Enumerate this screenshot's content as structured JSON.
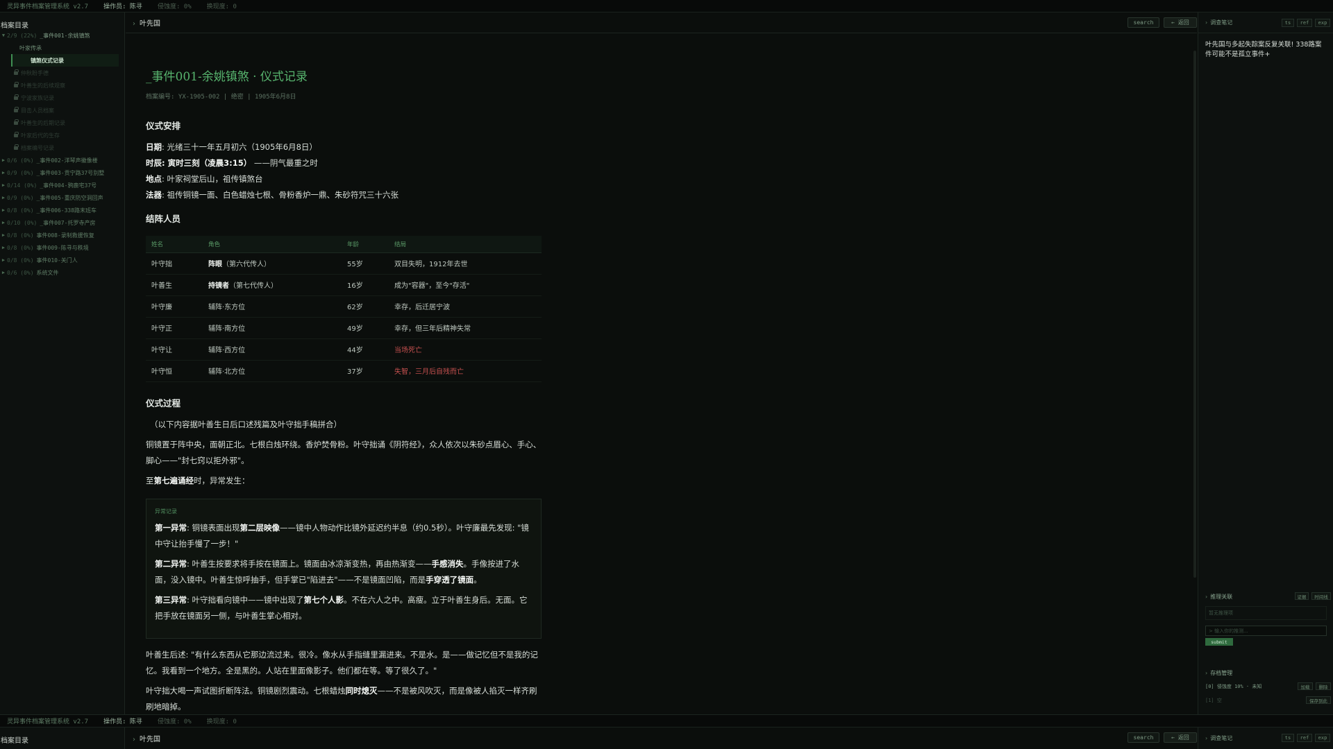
{
  "status": {
    "app": "灵异事件档案管理系统 v2.7",
    "operator": "操作员: 陈寻",
    "erosion": "侵蚀度: 0%",
    "anomaly": "换现度: 0"
  },
  "sidebar": {
    "title": "档案目录",
    "open_case": {
      "count": "2/9 (22%)",
      "name": "_事件001-余姚镇煞"
    },
    "sub_items": [
      {
        "label": "叶家传承",
        "state": "normal"
      },
      {
        "label": "镇煞仪式记录",
        "state": "active"
      },
      {
        "label": "仲秋盼手德",
        "state": "locked"
      },
      {
        "label": "叶善生的后续观察",
        "state": "locked"
      },
      {
        "label": "宁波家族记录",
        "state": "locked"
      },
      {
        "label": "目击人员档案",
        "state": "locked"
      },
      {
        "label": "叶善生的后期记录",
        "state": "locked"
      },
      {
        "label": "叶家后代的生存",
        "state": "locked"
      },
      {
        "label": "档案编号记录",
        "state": "locked"
      }
    ],
    "cases": [
      {
        "count": "0/6 (0%)",
        "name": "_事件002-洋琴声徽像楼"
      },
      {
        "count": "0/9 (0%)",
        "name": "_事件003-贡宁路37号别墅"
      },
      {
        "count": "0/14 (0%)",
        "name": "_事件004-鸦鹿宅37号"
      },
      {
        "count": "0/9 (0%)",
        "name": "_事件005-重庆防空洞回声"
      },
      {
        "count": "0/8 (0%)",
        "name": "_事件006-338路末班车"
      },
      {
        "count": "0/10 (0%)",
        "name": "_事件007-托罗寺产房"
      },
      {
        "count": "0/8 (0%)",
        "name": "事件008-录制救援恢复"
      },
      {
        "count": "0/8 (0%)",
        "name": "事件009-陈寻与秩境"
      },
      {
        "count": "0/8 (0%)",
        "name": "事件010-关门人"
      },
      {
        "count": "0/6 (0%)",
        "name": "系统文件"
      }
    ]
  },
  "header": {
    "breadcrumb": "叶先国",
    "search_label": "search",
    "back_label": "← 返回"
  },
  "doc": {
    "title": "_事件001-余姚镇煞 · 仪式记录",
    "meta": "档案编号: YX-1905-002 | 绝密 | 1905年6月8日",
    "sec1": "仪式安排",
    "arrangements": [
      {
        "key": "日期",
        "value": ": 光绪三十一年五月初六（1905年6月8日）",
        "strong": ""
      },
      {
        "key": "时辰",
        "value": " ——阴气最重之时",
        "strong": ": 寅时三刻（凌晨3:15）"
      },
      {
        "key": "地点",
        "value": ": 叶家祠堂后山，祖传镇煞台",
        "strong": ""
      },
      {
        "key": "法器",
        "value": ": 祖传铜镜一面、白色蜡烛七根、骨粉香炉一鼎、朱砂符咒三十六张",
        "strong": ""
      }
    ],
    "sec2": "结阵人员",
    "table_headers": [
      "姓名",
      "角色",
      "年龄",
      "结局"
    ],
    "people": [
      {
        "name": "叶守拙",
        "role_strong": "阵眼",
        "role_rest": "（第六代传人）",
        "age": "55岁",
        "fate": "双目失明，1912年去世",
        "red": false
      },
      {
        "name": "叶善生",
        "role_strong": "持镜者",
        "role_rest": "（第七代传人）",
        "age": "16岁",
        "fate": "成为\"容器\"，至今\"存活\"",
        "red": false
      },
      {
        "name": "叶守廉",
        "role_strong": "",
        "role_rest": "辅阵·东方位",
        "age": "62岁",
        "fate": "幸存，后迁居宁波",
        "red": false
      },
      {
        "name": "叶守正",
        "role_strong": "",
        "role_rest": "辅阵·南方位",
        "age": "49岁",
        "fate": "幸存，但三年后精神失常",
        "red": false
      },
      {
        "name": "叶守让",
        "role_strong": "",
        "role_rest": "辅阵·西方位",
        "age": "44岁",
        "fate": "当场死亡",
        "red": true
      },
      {
        "name": "叶守恒",
        "role_strong": "",
        "role_rest": "辅阵·北方位",
        "age": "37岁",
        "fate": "失智，三月后自残而亡",
        "red": true
      }
    ],
    "sec3": "仪式过程",
    "intro": "（以下内容据叶善生日后口述残篇及叶守拙手稿拼合）",
    "p1": "铜镜置于阵中央，面朝正北。七根白烛环绕。香炉焚骨粉。叶守拙诵《阴符经》，众人依次以朱砂点眉心、手心、脚心——\"封七窍以拒外邪\"。",
    "p2_pre": "至",
    "p2_strong": "第七遍诵经",
    "p2_post": "时，异常发生：",
    "anomaly_label": "异常记录",
    "anomalies": [
      {
        "head": "第一异常",
        "a": ": 铜镜表面出现",
        "b": "第二层映像",
        "c": "——镜中人物动作比镜外延迟约半息（约0.5秒）。叶守廉最先发现: \"镜中守让抬手慢了一步！\"",
        "d": "",
        "e": ""
      },
      {
        "head": "第二异常",
        "a": ": 叶善生按要求将手按在镜面上。镜面由冰凉渐变热，再由热渐变——",
        "b": "手感消失",
        "c": "。手像按进了水面，没入镜中。叶善生惊呼抽手，但手掌已\"陷进去\"——不是镜面凹陷，而是",
        "d": "手穿透了镜面",
        "e": "。"
      },
      {
        "head": "第三异常",
        "a": ": 叶守拙看向镜中——镜中出现了",
        "b": "第七个人影",
        "c": "。不在六人之中。高瘦。立于叶善生身后。无面。它把手放在镜面另一侧，与叶善生掌心相对。",
        "d": "",
        "e": ""
      }
    ],
    "p3": "叶善生后述: \"有什么东西从它那边流过来。很冷。像水从手指缝里漏进来。不是水。是——做记忆但不是我的记忆。我看到一个地方。全是黑的。人站在里面像影子。他们都在等。等了很久了。\"",
    "p4_pre": "叶守拙大喝一声试图折断阵法。铜镜剧烈震动。七根蜡烛",
    "p4_strong": "同时熄灭",
    "p4_post": "——不是被风吹灭，而是像被人掐灭一样齐刷刷地暗掉。"
  },
  "right": {
    "title": "调查笔记",
    "btn_ts": "ts",
    "btn_ref": "ref",
    "btn_exp": "exp",
    "note": "叶先国与多起失踪案反复关联! 338路案件可能不是孤立事件+",
    "assoc_title": "推理关联",
    "assoc_btn1": "证据",
    "assoc_btn2": "时间线",
    "assoc_empty": "暂无推理项",
    "assoc_placeholder": "> 输入你的推测...",
    "submit": "submit",
    "save_title": "存档管理",
    "save1": "[0] 侵蚀度 10% · 未知",
    "save1_btn1": "加载",
    "save1_btn2": "删除",
    "save2": "[1] 空",
    "save2_btn": "保存到此"
  },
  "colors": {
    "accent": "#57b46e",
    "danger": "#c4504f",
    "bg": "#0b0e0c"
  }
}
